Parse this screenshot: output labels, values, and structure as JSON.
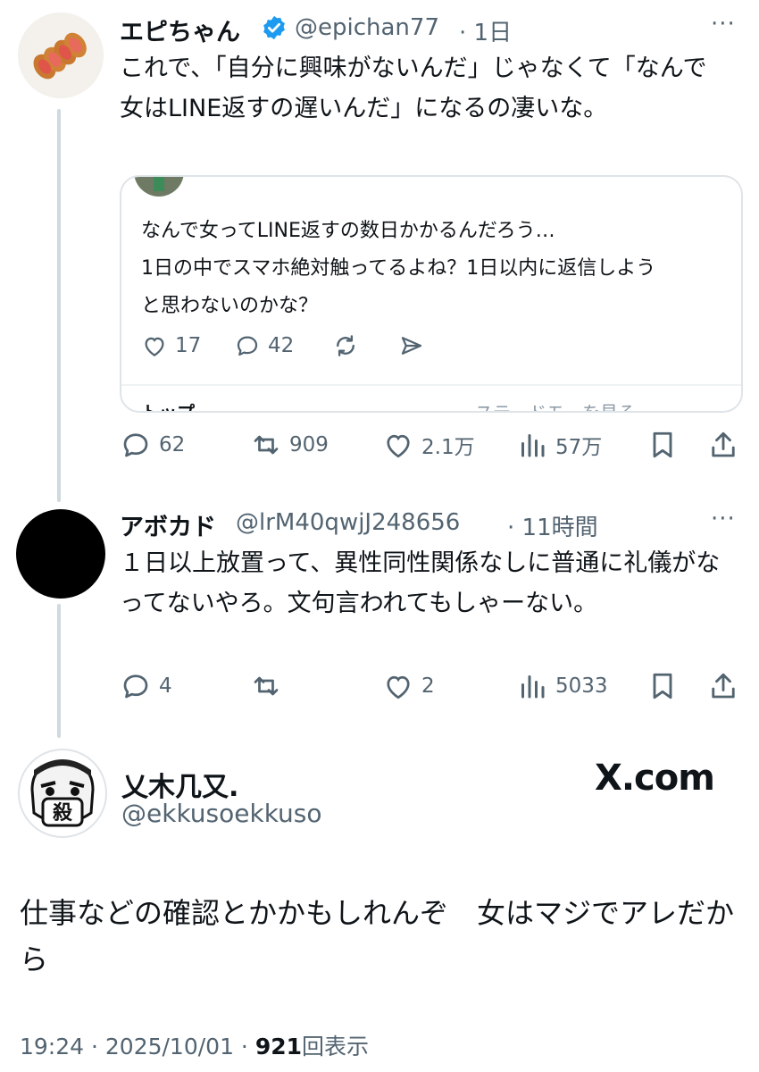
{
  "post1": {
    "name": "エピちゃん",
    "handle": "@epichan77",
    "time": "· 1日",
    "more": "···",
    "text": "これで、「自分に興味がないんだ」じゃなくて「なんで女はLINE返すの遅いんだ」になるの凄いな。",
    "quote": {
      "text": "なんで女ってLINE返すの数日かかるんだろう…\n1日の中でスマホ絶対触ってるよね？1日以内に返信しようと思わないのかな？",
      "likes": "17",
      "replies": "42",
      "cut_left": "トップ",
      "cut_right": "ステ…ドモ…を見る"
    },
    "replies": "62",
    "reposts": "909",
    "likes": "2.1万",
    "views": "57万"
  },
  "post2": {
    "name": "アボカド",
    "handle": "@lrM40qwjJ248656",
    "time": "· 11時間",
    "more": "···",
    "text": "１日以上放置って、異性同性関係なしに普通に礼儀がなってないやろ。文句言われてもしゃーない。",
    "replies": "4",
    "reposts": "",
    "likes": "2",
    "views": "5033"
  },
  "post3": {
    "name": "乂木几又.",
    "handle": "@ekkusoekkuso",
    "brand": "X.com",
    "text": "仕事などの確認とかかもしれんぞ　女はマジでアレだから",
    "timestamp": "19:24 · 2025/10/01 · ",
    "views_count": "921",
    "views_label": "回表示",
    "avatar_mask_char": "殺"
  },
  "colors": {
    "muted": "#536471",
    "verified": "#1d9bf0",
    "border": "#dfe4e8"
  }
}
